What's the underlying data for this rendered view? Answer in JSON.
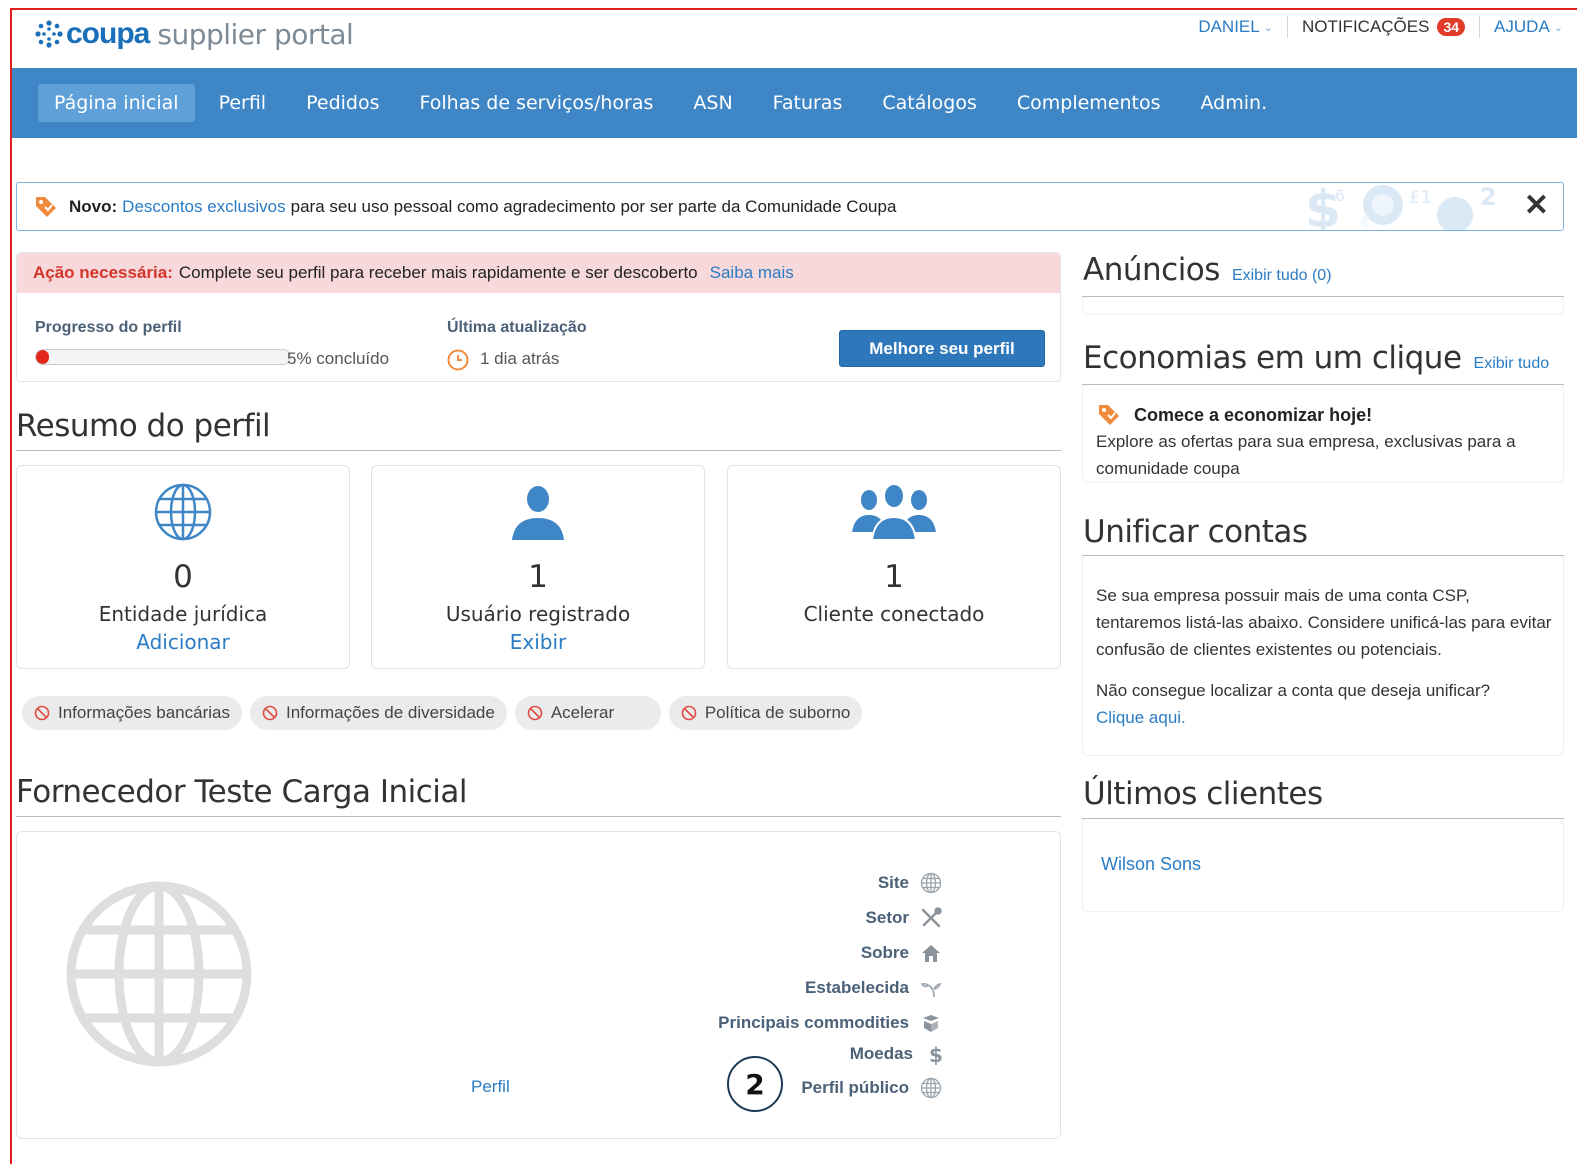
{
  "header": {
    "logo_brand": "coupa",
    "logo_rest": "supplier portal",
    "user": "DANIEL",
    "notifications_label": "NOTIFICAÇÕES",
    "notifications_count": "34",
    "help": "AJUDA"
  },
  "nav": {
    "items": [
      "Página inicial",
      "Perfil",
      "Pedidos",
      "Folhas de serviços/horas",
      "ASN",
      "Faturas",
      "Catálogos",
      "Complementos",
      "Admin."
    ],
    "active_index": 0
  },
  "promo": {
    "prefix": "Novo:",
    "link": "Descontos exclusivos",
    "text": "para seu uso pessoal como agradecimento por ser parte da Comunidade Coupa",
    "close": "✕"
  },
  "action": {
    "required_label": "Ação necessária:",
    "message": "Complete seu perfil para receber mais rapidamente e ser descoberto",
    "learn_more": "Saiba mais",
    "progress_label": "Progresso do perfil",
    "progress_value": 5,
    "progress_text": "5% concluído",
    "last_update_label": "Última atualização",
    "last_update_value": "1 dia atrás",
    "improve_button": "Melhore seu perfil"
  },
  "profile_summary": {
    "title": "Resumo do perfil",
    "cards": [
      {
        "icon": "globe-icon",
        "count": "0",
        "label": "Entidade jurídica",
        "action": "Adicionar"
      },
      {
        "icon": "user-icon",
        "count": "1",
        "label": "Usuário registrado",
        "action": "Exibir"
      },
      {
        "icon": "users-icon",
        "count": "1",
        "label": "Cliente conectado",
        "action": ""
      }
    ],
    "pills": [
      "Informações bancárias",
      "Informações de diversidade",
      "Acelerar",
      "Política de suborno"
    ]
  },
  "supplier": {
    "title": "Fornecedor Teste Carga Inicial",
    "rows": [
      {
        "label": "Site",
        "icon": "globe-icon"
      },
      {
        "label": "Setor",
        "icon": "tools-icon"
      },
      {
        "label": "Sobre",
        "icon": "house-icon"
      },
      {
        "label": "Estabelecida",
        "icon": "sprout-icon"
      },
      {
        "label": "Principais commodities",
        "icon": "box-icon"
      },
      {
        "label": "Moedas",
        "icon": "dollar-icon"
      },
      {
        "label": "Perfil público",
        "icon": "globe-icon"
      }
    ],
    "public_profile_link": "Perfil",
    "step_marker": "2"
  },
  "sidebar": {
    "announcements_title": "Anúncios",
    "announcements_link": "Exibir tudo (0)",
    "savings_title": "Economias em um clique",
    "savings_link": "Exibir tudo",
    "savings_heading": "Comece a economizar hoje!",
    "savings_text": "Explore as ofertas para sua empresa, exclusivas para a comunidade coupa",
    "merge_title": "Unificar contas",
    "merge_text": "Se sua empresa possuir mais de uma conta CSP, tentaremos listá-las abaixo. Considere unificá-las para evitar confusão de clientes existentes ou potenciais.",
    "merge_question": "Não consegue localizar a conta que deseja unificar?",
    "merge_link": "Clique aqui.",
    "clients_title": "Últimos clientes",
    "clients": [
      "Wilson Sons"
    ]
  },
  "colors": {
    "brand": "#1a6fb8",
    "nav_bg": "#3f86c6",
    "link": "#2a7cc4",
    "alert_bg": "#f7d9dc",
    "alert_text": "#d5342b",
    "progress_fill": "#e3251c",
    "badge": "#e23b2a"
  }
}
